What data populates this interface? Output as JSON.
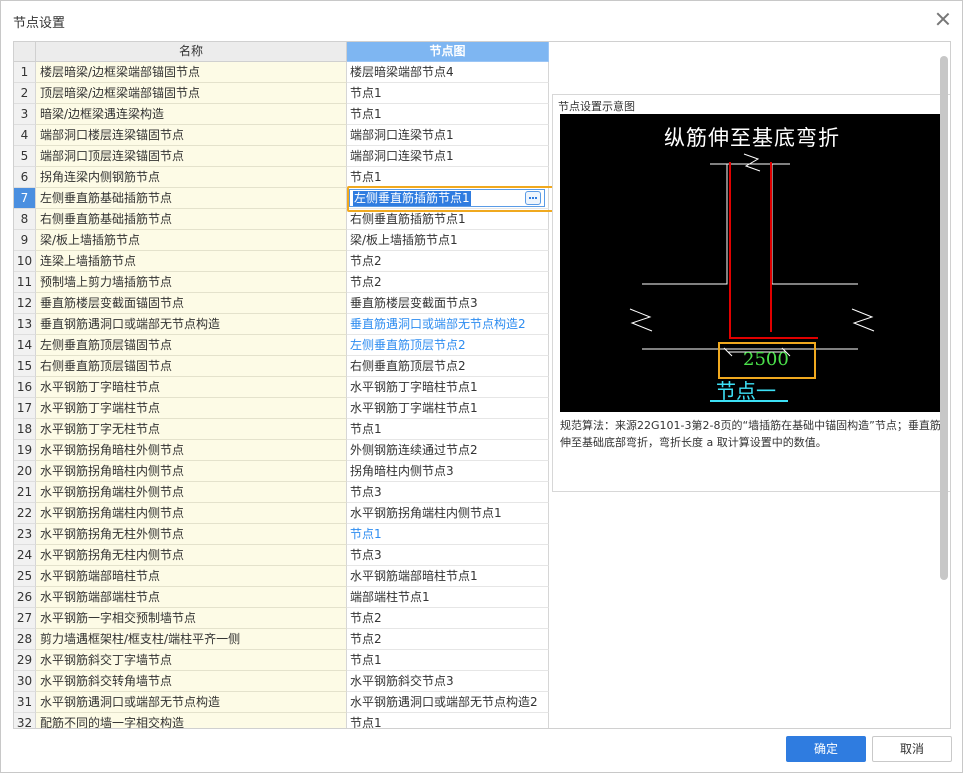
{
  "dialog": {
    "title": "节点设置"
  },
  "table": {
    "headers": {
      "name": "名称",
      "node": "节点图"
    },
    "rows": [
      {
        "num": "1",
        "name": "楼层暗梁/边框梁端部锚固节点",
        "node": "楼层暗梁端部节点4"
      },
      {
        "num": "2",
        "name": "顶层暗梁/边框梁端部锚固节点",
        "node": "节点1"
      },
      {
        "num": "3",
        "name": "暗梁/边框梁遇连梁构造",
        "node": "节点1"
      },
      {
        "num": "4",
        "name": "端部洞口楼层连梁锚固节点",
        "node": "端部洞口连梁节点1"
      },
      {
        "num": "5",
        "name": "端部洞口顶层连梁锚固节点",
        "node": "端部洞口连梁节点1"
      },
      {
        "num": "6",
        "name": "拐角连梁内侧钢筋节点",
        "node": "节点1"
      },
      {
        "num": "7",
        "name": "左侧垂直筋基础插筋节点",
        "node": "左侧垂直筋插筋节点1"
      },
      {
        "num": "8",
        "name": "右侧垂直筋基础插筋节点",
        "node": "右侧垂直筋插筋节点1"
      },
      {
        "num": "9",
        "name": "梁/板上墙插筋节点",
        "node": "梁/板上墙插筋节点1"
      },
      {
        "num": "10",
        "name": "连梁上墙插筋节点",
        "node": "节点2"
      },
      {
        "num": "11",
        "name": "预制墙上剪力墙插筋节点",
        "node": "节点2"
      },
      {
        "num": "12",
        "name": "垂直筋楼层变截面锚固节点",
        "node": "垂直筋楼层变截面节点3"
      },
      {
        "num": "13",
        "name": "垂直钢筋遇洞口或端部无节点构造",
        "node": "垂直筋遇洞口或端部无节点构造2"
      },
      {
        "num": "14",
        "name": "左侧垂直筋顶层锚固节点",
        "node": "左侧垂直筋顶层节点2"
      },
      {
        "num": "15",
        "name": "右侧垂直筋顶层锚固节点",
        "node": "右侧垂直筋顶层节点2"
      },
      {
        "num": "16",
        "name": "水平钢筋丁字暗柱节点",
        "node": "水平钢筋丁字暗柱节点1"
      },
      {
        "num": "17",
        "name": "水平钢筋丁字端柱节点",
        "node": "水平钢筋丁字端柱节点1"
      },
      {
        "num": "18",
        "name": "水平钢筋丁字无柱节点",
        "node": "节点1"
      },
      {
        "num": "19",
        "name": "水平钢筋拐角暗柱外侧节点",
        "node": "外侧钢筋连续通过节点2"
      },
      {
        "num": "20",
        "name": "水平钢筋拐角暗柱内侧节点",
        "node": "拐角暗柱内侧节点3"
      },
      {
        "num": "21",
        "name": "水平钢筋拐角端柱外侧节点",
        "node": "节点3"
      },
      {
        "num": "22",
        "name": "水平钢筋拐角端柱内侧节点",
        "node": "水平钢筋拐角端柱内侧节点1"
      },
      {
        "num": "23",
        "name": "水平钢筋拐角无柱外侧节点",
        "node": "节点1"
      },
      {
        "num": "24",
        "name": "水平钢筋拐角无柱内侧节点",
        "node": "节点3"
      },
      {
        "num": "25",
        "name": "水平钢筋端部暗柱节点",
        "node": "水平钢筋端部暗柱节点1"
      },
      {
        "num": "26",
        "name": "水平钢筋端部端柱节点",
        "node": "端部端柱节点1"
      },
      {
        "num": "27",
        "name": "水平钢筋一字相交预制墙节点",
        "node": "节点2"
      },
      {
        "num": "28",
        "name": "剪力墙遇框架柱/框支柱/端柱平齐一侧",
        "node": "节点2"
      },
      {
        "num": "29",
        "name": "水平钢筋斜交丁字墙节点",
        "node": "节点1"
      },
      {
        "num": "30",
        "name": "水平钢筋斜交转角墙节点",
        "node": "水平钢筋斜交节点3"
      },
      {
        "num": "31",
        "name": "水平钢筋遇洞口或端部无节点构造",
        "node": "水平钢筋遇洞口或端部无节点构造2"
      },
      {
        "num": "32",
        "name": "配筋不同的墙一字相交构造",
        "node": "节点1"
      }
    ],
    "selected_row": 7,
    "link_rows": [
      13,
      14,
      23
    ]
  },
  "preview": {
    "title": "节点设置示意图",
    "diagram_title": "纵筋伸至基底弯折",
    "dimension": "2500",
    "node_label": "节点一",
    "description": "规范算法：来源22G101-3第2-8页的“墙插筋在基础中锚固构造”节点；垂直筋伸至基础底部弯折，弯折长度 a 取计算设置中的数值。",
    "colors": {
      "background": "#000000",
      "rebar": "#e00000",
      "outline": "#ffffff",
      "dimension": "#4be14b",
      "label": "#3de0f5"
    }
  },
  "buttons": {
    "ok": "确定",
    "cancel": "取消"
  },
  "colors": {
    "accent": "#2f7ce0",
    "header_selected": "#7eb6f2",
    "name_cell": "#fdfbe6",
    "link": "#2d8cf0",
    "highlight": "#f0a91f"
  }
}
